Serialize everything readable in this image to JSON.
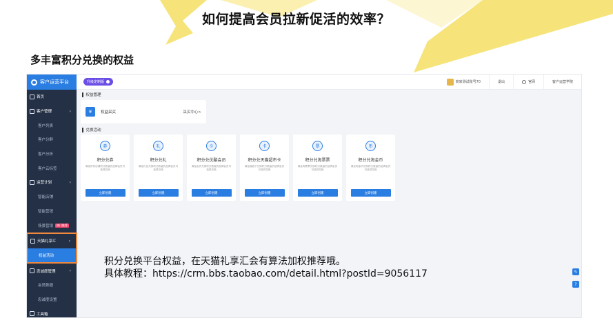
{
  "slide": {
    "title": "如何提高会员拉新促活的效率？",
    "subtitle": "多丰富积分兑换的权益",
    "note_line1": "积分兑换平台权益，在天猫礼享汇会有算法加权推荐哦。",
    "note_line2": "具体教程：https://crm.bbs.taobao.com/detail.html?postId=9056117"
  },
  "colors": {
    "accent": "#2a7de1",
    "sidebar": "#233046",
    "highlight_border": "#f0883e",
    "deco_yellow": "#f6e47a",
    "upgrade": "#6b4ee6"
  },
  "app": {
    "brand": "客户运营平台",
    "upgrade_badge": "升级定制版",
    "merchant": "商家测试账号70",
    "logout": "退出",
    "official_site": "官网",
    "academy": "客户运营学院"
  },
  "sidebar": {
    "items": [
      {
        "label": "首页",
        "kind": "top",
        "icon": "home-icon"
      },
      {
        "label": "客户管理",
        "kind": "top",
        "icon": "users-icon",
        "arrow": "›"
      },
      {
        "label": "客户列表",
        "kind": "sub"
      },
      {
        "label": "客户分群",
        "kind": "sub"
      },
      {
        "label": "客户分析",
        "kind": "sub"
      },
      {
        "label": "客户云标签",
        "kind": "sub"
      },
      {
        "label": "运营计划",
        "kind": "top",
        "icon": "plan-icon",
        "arrow": "›"
      },
      {
        "label": "智能店铺",
        "kind": "sub"
      },
      {
        "label": "智能营销",
        "kind": "sub"
      },
      {
        "label": "场景营销",
        "kind": "sub",
        "badge": "热门推荐"
      },
      {
        "label": "天猫礼享汇",
        "kind": "top",
        "icon": "gift-icon",
        "arrow": "›"
      },
      {
        "label": "权益活动",
        "kind": "sub"
      },
      {
        "label": "忠诚度管理",
        "kind": "top",
        "icon": "loyalty-icon",
        "arrow": "›"
      },
      {
        "label": "会员数据",
        "kind": "sub"
      },
      {
        "label": "忠诚度设置",
        "kind": "sub"
      },
      {
        "label": "工具箱",
        "kind": "top",
        "icon": "toolbox-icon"
      }
    ]
  },
  "main": {
    "rights_section": "权益管理",
    "purchase_label": "权益采买",
    "purchase_link": "采买中心>",
    "exchange_section": "兑换活动",
    "create_label": "立即创建",
    "cards": [
      {
        "title": "积分兑券",
        "desc": "满足所有店铺积分数量的品牌会员可选择兑换",
        "glyph": "券"
      },
      {
        "title": "积分兑礼",
        "desc": "满足礼包兑换积分数量的品牌会员可选择兑换",
        "glyph": "礼"
      },
      {
        "title": "积分兑优酷会员",
        "desc": "满足会员兑换积分数量的品牌会员可选择兑换",
        "glyph": "◎"
      },
      {
        "title": "积分兑天猫超市卡",
        "desc": "满足猫超卡兑换积分数量的品牌会员可选择兑换",
        "glyph": "卡"
      },
      {
        "title": "积分兑淘票票",
        "desc": "满足淘票票兑换积分数量的品牌会员可选择兑换",
        "glyph": "票"
      },
      {
        "title": "积分兑淘金币",
        "desc": "满足淘金币兑换积分数量的品牌会员可选择兑换",
        "glyph": "币"
      }
    ]
  }
}
